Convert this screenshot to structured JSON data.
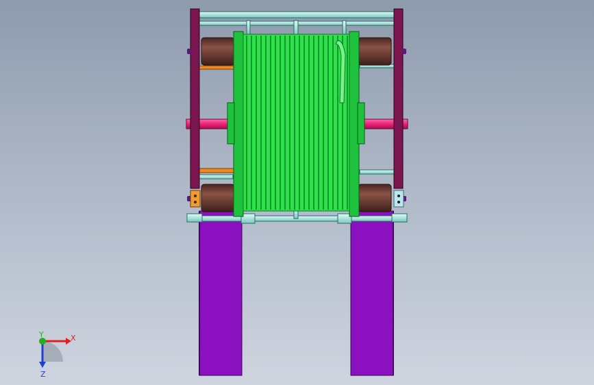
{
  "app": {
    "view": "CAD 3D viewport"
  },
  "triad": {
    "x_label": "X",
    "y_label": "Y",
    "z_label": "Z",
    "x_color": "#e02020",
    "y_color": "#20b020",
    "z_color": "#2040d0"
  },
  "colors": {
    "background_top": "#8e9bad",
    "background_bottom": "#cfd5df",
    "drum_green": "#2ee04a",
    "drum_dark": "#0a7a22",
    "frame_maroon": "#7a1550",
    "legs_purple": "#8a10c0",
    "rollers_brown": "#6b3a2e",
    "rods_cyan": "#9fe8e0",
    "axle_pink": "#f0207a",
    "rod_orange": "#f08a20"
  },
  "icons": [
    "axis-triad-icon"
  ]
}
